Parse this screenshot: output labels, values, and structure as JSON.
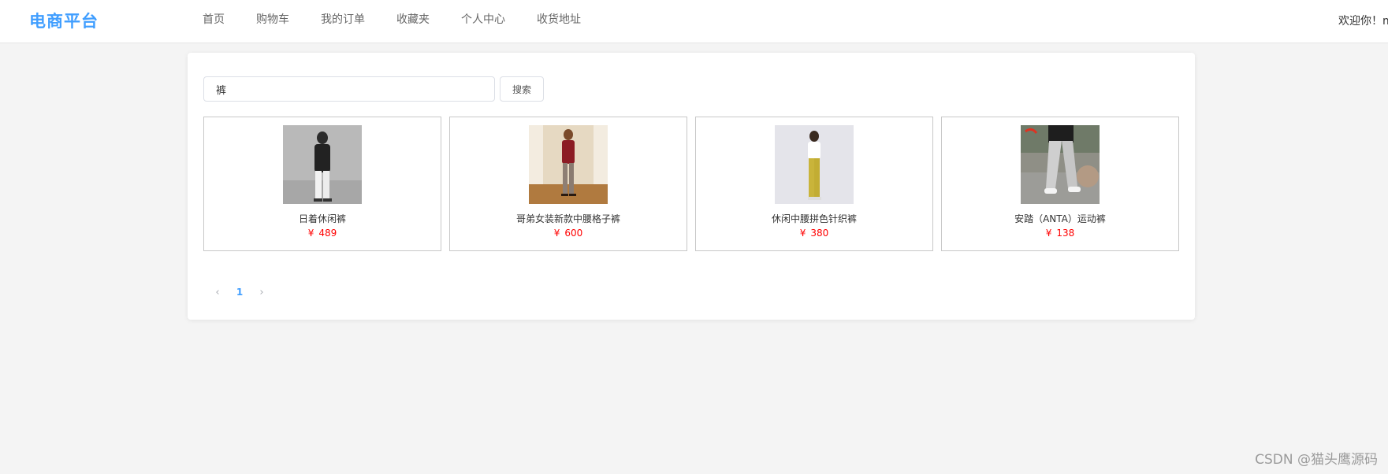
{
  "header": {
    "logo": "电商平台",
    "nav": [
      "首页",
      "购物车",
      "我的订单",
      "收藏夹",
      "个人中心",
      "收货地址"
    ],
    "welcome": "欢迎你！m"
  },
  "search": {
    "value": "裤",
    "button_label": "搜索"
  },
  "products": [
    {
      "name": "日着休闲裤",
      "currency": "¥",
      "price": "489"
    },
    {
      "name": "哥弟女装新款中腰格子裤",
      "currency": "¥",
      "price": "600"
    },
    {
      "name": "休闲中腰拼色针织裤",
      "currency": "¥",
      "price": "380"
    },
    {
      "name": "安踏（ANTA）运动裤",
      "currency": "¥",
      "price": "138"
    }
  ],
  "pagination": {
    "prev_icon": "chevron-left-icon",
    "current_page": "1",
    "next_icon": "chevron-right-icon"
  },
  "watermark": "CSDN @猫头鹰源码",
  "colors": {
    "accent": "#409eff",
    "price": "#ff0000",
    "background": "#f4f4f4"
  }
}
